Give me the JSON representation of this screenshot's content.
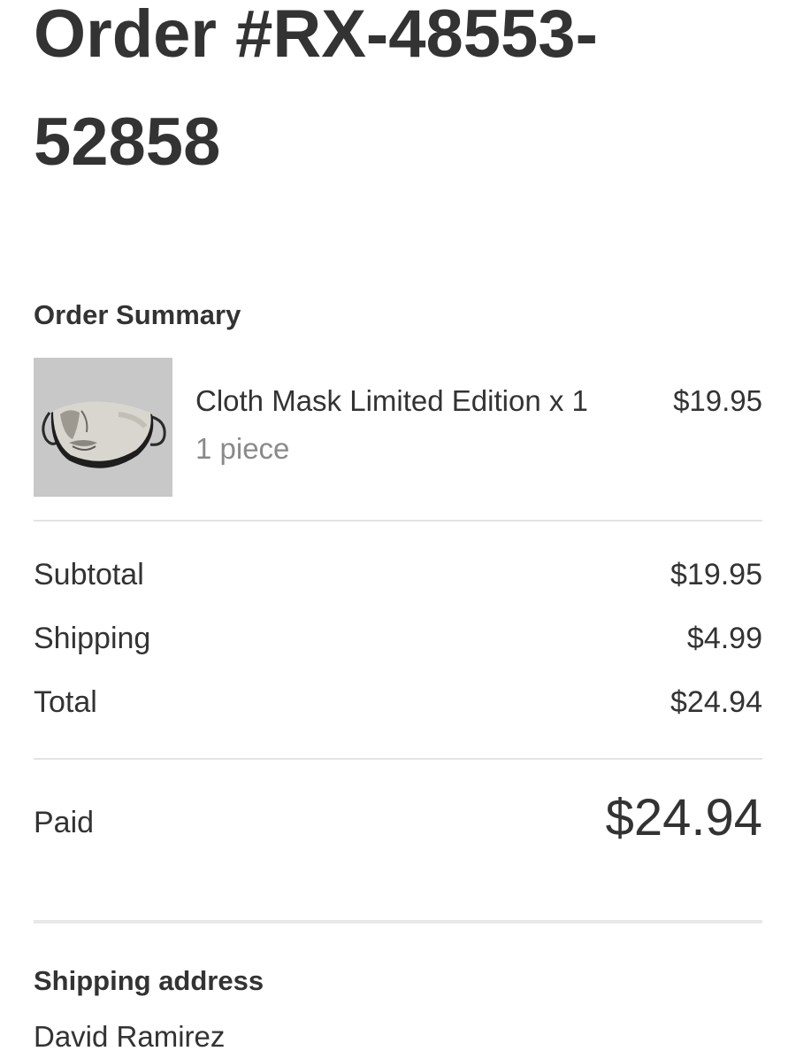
{
  "order": {
    "title": "Order #RX-48553-52858"
  },
  "summary": {
    "heading": "Order Summary",
    "items": [
      {
        "image_icon": "cloth-mask-product-image",
        "name": "Cloth Mask Limited Edition x 1",
        "variant": "1 piece",
        "price": "$19.95"
      }
    ],
    "subtotal_label": "Subtotal",
    "subtotal_value": "$19.95",
    "shipping_label": "Shipping",
    "shipping_value": "$4.99",
    "total_label": "Total",
    "total_value": "$24.94",
    "paid_label": "Paid",
    "paid_value": "$24.94"
  },
  "shipping_address": {
    "heading": "Shipping address",
    "name": "David Ramirez"
  },
  "colors": {
    "text": "#333333",
    "muted": "#8a8a8a",
    "divider": "#e3e3e3",
    "background": "#ffffff"
  }
}
